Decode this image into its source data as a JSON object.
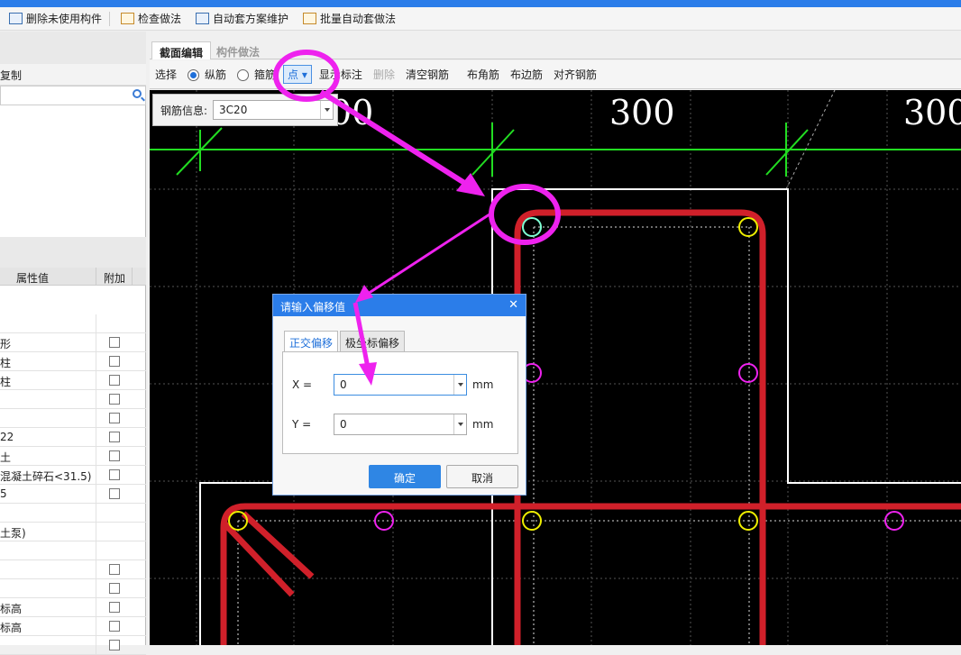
{
  "toolbar": {
    "items": [
      {
        "label": "删除未使用构件",
        "icon": "list-icon"
      },
      {
        "label": "检查做法",
        "icon": "check-icon"
      },
      {
        "label": "自动套方案维护",
        "icon": "scheme-icon"
      },
      {
        "label": "批量自动套做法",
        "icon": "batch-icon"
      }
    ]
  },
  "left_panel": {
    "header_label": "复制",
    "search_placeholder": "",
    "property_columns": {
      "value": "属性值",
      "extra": "附加"
    },
    "property_rows": [
      {
        "value": "",
        "checkbox": false
      },
      {
        "value": "形",
        "checkbox": true
      },
      {
        "value": "柱",
        "checkbox": true
      },
      {
        "value": "柱",
        "checkbox": true
      },
      {
        "value": "",
        "checkbox": true
      },
      {
        "value": "",
        "checkbox": true
      },
      {
        "value": "22",
        "checkbox": true
      },
      {
        "value": "土",
        "checkbox": true
      },
      {
        "value": "混凝土碎石<31.5)",
        "checkbox": true
      },
      {
        "value": "5",
        "checkbox": true
      },
      {
        "value": "",
        "checkbox": false
      },
      {
        "value": "土泵)",
        "checkbox": false
      },
      {
        "value": "",
        "checkbox": false
      },
      {
        "value": "",
        "checkbox": true
      },
      {
        "value": "",
        "checkbox": true
      },
      {
        "value": "标高",
        "checkbox": true
      },
      {
        "value": "标高",
        "checkbox": true
      },
      {
        "value": "",
        "checkbox": true
      }
    ]
  },
  "editor_tabs": [
    {
      "label": "截面编辑",
      "active": true
    },
    {
      "label": "构件做法",
      "active": false
    }
  ],
  "sub_toolbar": {
    "select": "选择",
    "radio_longitudinal": "纵筋",
    "radio_stirrup": "箍筋",
    "point_dropdown": "点",
    "show_label": "显示标注",
    "delete": "删除",
    "clear": "清空钢筋",
    "corner": "布角筋",
    "edge": "布边筋",
    "align": "对齐钢筋"
  },
  "rebar_info": {
    "label": "钢筋信息:",
    "value": "3C20"
  },
  "dimensions": [
    "00",
    "300",
    "300"
  ],
  "dialog": {
    "title": "请输入偏移值",
    "tabs": [
      {
        "label": "正交偏移",
        "active": true
      },
      {
        "label": "极坐标偏移",
        "active": false
      }
    ],
    "x_label": "X =",
    "x_value": "0",
    "y_label": "Y =",
    "y_value": "0",
    "unit": "mm",
    "ok": "确定",
    "cancel": "取消"
  },
  "colors": {
    "rebar": "#d0202a",
    "dim_line": "#22dd22",
    "highlight": "#ee22ee",
    "accent": "#2b7de9"
  }
}
